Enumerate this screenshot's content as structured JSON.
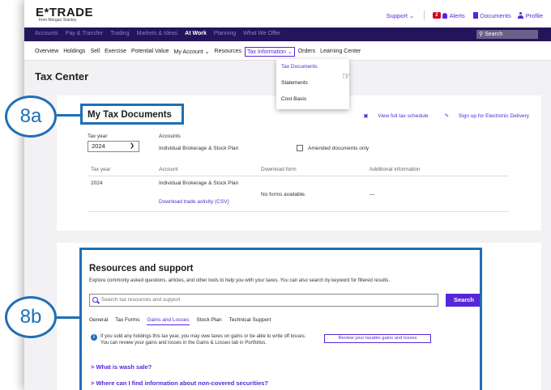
{
  "brand": {
    "logo": "E*TRADE",
    "sub": "from Morgan Stanley"
  },
  "top_links": {
    "support": "Support ⌄",
    "alerts_count": "2",
    "alerts": "Alerts",
    "documents": "Documents",
    "profile": "Profile"
  },
  "main_nav": [
    "Accounts",
    "Pay & Transfer",
    "Trading",
    "Markets & Ideas",
    "At Work",
    "Planning",
    "What We Offer"
  ],
  "main_nav_active": "At Work",
  "nav_search": "Search",
  "sub_nav": [
    "Overview",
    "Holdings",
    "Sell",
    "Exercise",
    "Potential Value",
    "My Account ⌄",
    "Resources",
    "Tax Information ⌄",
    "Orders",
    "Learning Center"
  ],
  "dropdown": [
    "Tax Documents",
    "Statements",
    "Cost Basis"
  ],
  "page_title": "Tax Center",
  "callouts": {
    "a": "8a",
    "b": "8b"
  },
  "tax_docs": {
    "title": "My Tax Documents",
    "link_schedule": "View full tax schedule",
    "link_delivery": "Sign up for Electronic Delivery",
    "tax_year_label": "Tax year",
    "tax_year_value": "2024",
    "accounts_label": "Accounts",
    "accounts_value": "Individual Brokerage & Stock Plan",
    "amended": "Amended documents only",
    "headers": [
      "Tax year",
      "Account",
      "Download form",
      "Additional information"
    ],
    "row": {
      "year": "2024",
      "account": "Individual Brokerage & Stock Plan",
      "download_csv": "Download trade activity (CSV)",
      "forms": "No forms available.",
      "additional": "—"
    }
  },
  "resources": {
    "title": "Resources and support",
    "description": "Explore commonly asked questions, articles, and other tools to help you with your taxes. You can also search by keyword for filtered results.",
    "search_placeholder": "Search tax resources and support",
    "search_button": "Search",
    "tabs": [
      "General",
      "Tax Forms",
      "Gains and Losses",
      "Stock Plan",
      "Technical Support"
    ],
    "active_tab": "Gains and Losses",
    "info": "If you sold any holdings this tax year, you may owe taxes on gains or be able to write off losses. You can review your gains and losses in the Gains & Losses tab in Portfolios.",
    "review_button": "Review your taxable gains and losses",
    "faqs": [
      "> What is wash sale?",
      "> Where can I find information about non-covered securities?"
    ]
  }
}
